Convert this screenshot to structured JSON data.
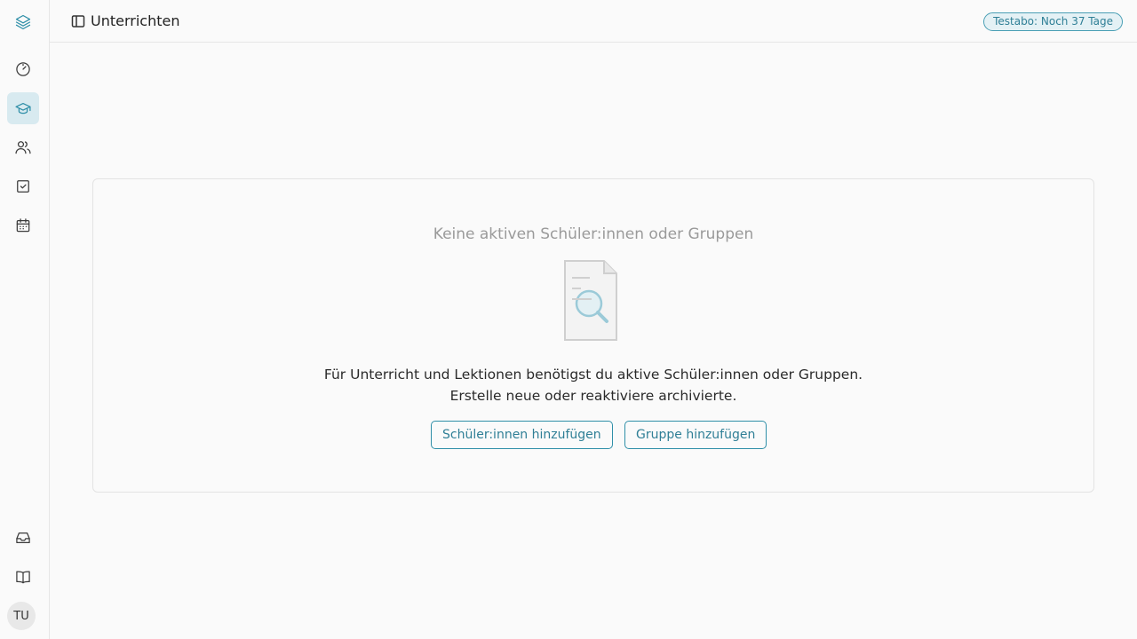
{
  "app": {
    "colors": {
      "accent": "#2f8fa8",
      "accent_bg": "#d8eaf0",
      "muted_text": "#9a9a9a"
    }
  },
  "sidebar": {
    "logo_icon": "layers-icon",
    "items": [
      {
        "name": "dashboard",
        "icon": "gauge-icon",
        "active": false
      },
      {
        "name": "teaching",
        "icon": "graduation-cap-icon",
        "active": true
      },
      {
        "name": "students",
        "icon": "users-icon",
        "active": false
      },
      {
        "name": "tasks",
        "icon": "checkbox-icon",
        "active": false
      },
      {
        "name": "calendar",
        "icon": "calendar-icon",
        "active": false
      }
    ],
    "bottom_items": [
      {
        "name": "inbox",
        "icon": "inbox-icon"
      },
      {
        "name": "docs",
        "icon": "book-icon"
      }
    ],
    "avatar_initials": "TU"
  },
  "header": {
    "toggle_icon": "sidebar-toggle-icon",
    "title": "Unterrichten",
    "trial_badge": "Testabo: Noch 37 Tage"
  },
  "empty_state": {
    "heading": "Keine aktiven Schüler:innen oder Gruppen",
    "illustration": "document-search-icon",
    "description": "Für Unterricht und Lektionen benötigst du aktive Schüler:innen oder Gruppen. Erstelle neue oder reaktiviere archivierte.",
    "add_students_label": "Schüler:innen hinzufügen",
    "add_group_label": "Gruppe hinzufügen"
  }
}
